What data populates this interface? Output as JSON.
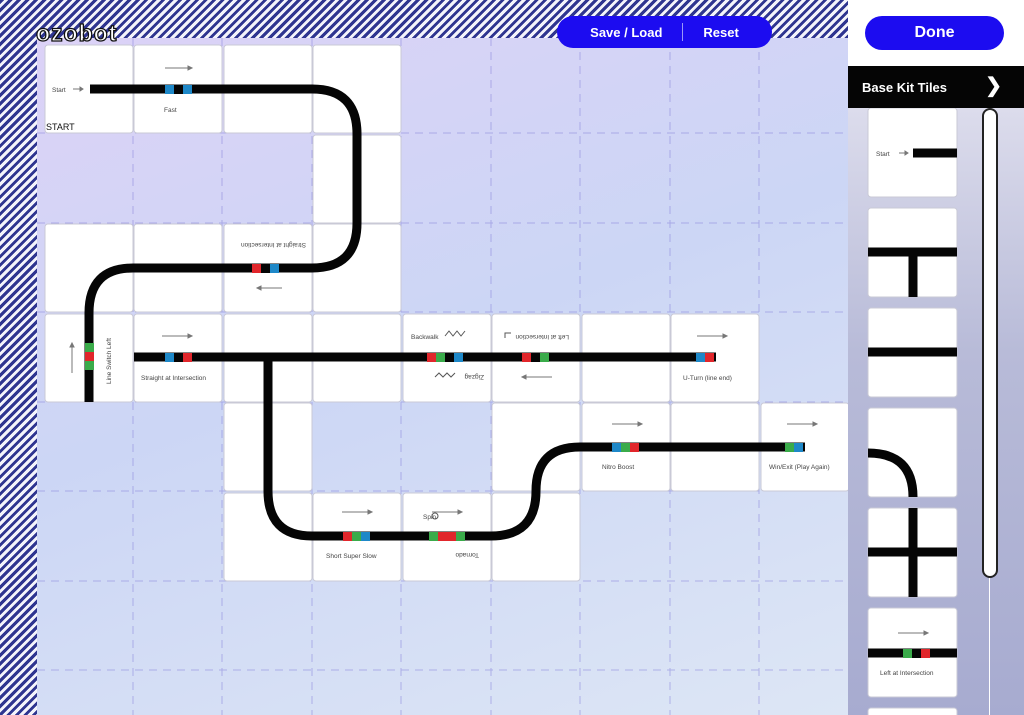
{
  "app": {
    "logo": "ozobot"
  },
  "toolbar": {
    "save_load": "Save / Load",
    "reset": "Reset"
  },
  "sidebar": {
    "done": "Done",
    "kit_title": "Base Kit Tiles"
  },
  "board_labels": {
    "start": "Start",
    "start_caption": "START",
    "fast": "Fast",
    "straight_at_intersection_flipped": "Straight at Intersection",
    "line_switch_left": "Line Switch Left",
    "straight_at_intersection": "Straight at Intersection",
    "backwalk": "Backwalk",
    "zigzag": "Zigzag",
    "left_at_intersection": "Left at Intersection",
    "u_turn": "U-Turn (line end)",
    "nitro_boost": "Nitro Boost",
    "win_exit": "Win/Exit (Play Again)",
    "short_super_slow": "Short Super Slow",
    "spin": "Spin",
    "tornado": "Tornado"
  },
  "kit_tiles": {
    "start": "Start",
    "left_at_intersection": "Left at Intersection"
  },
  "colors": {
    "accent_blue": "#1c0cf0",
    "track_black": "#050505",
    "code_red": "#e1262b",
    "code_green": "#3aab4a",
    "code_blue": "#1e88c8"
  }
}
